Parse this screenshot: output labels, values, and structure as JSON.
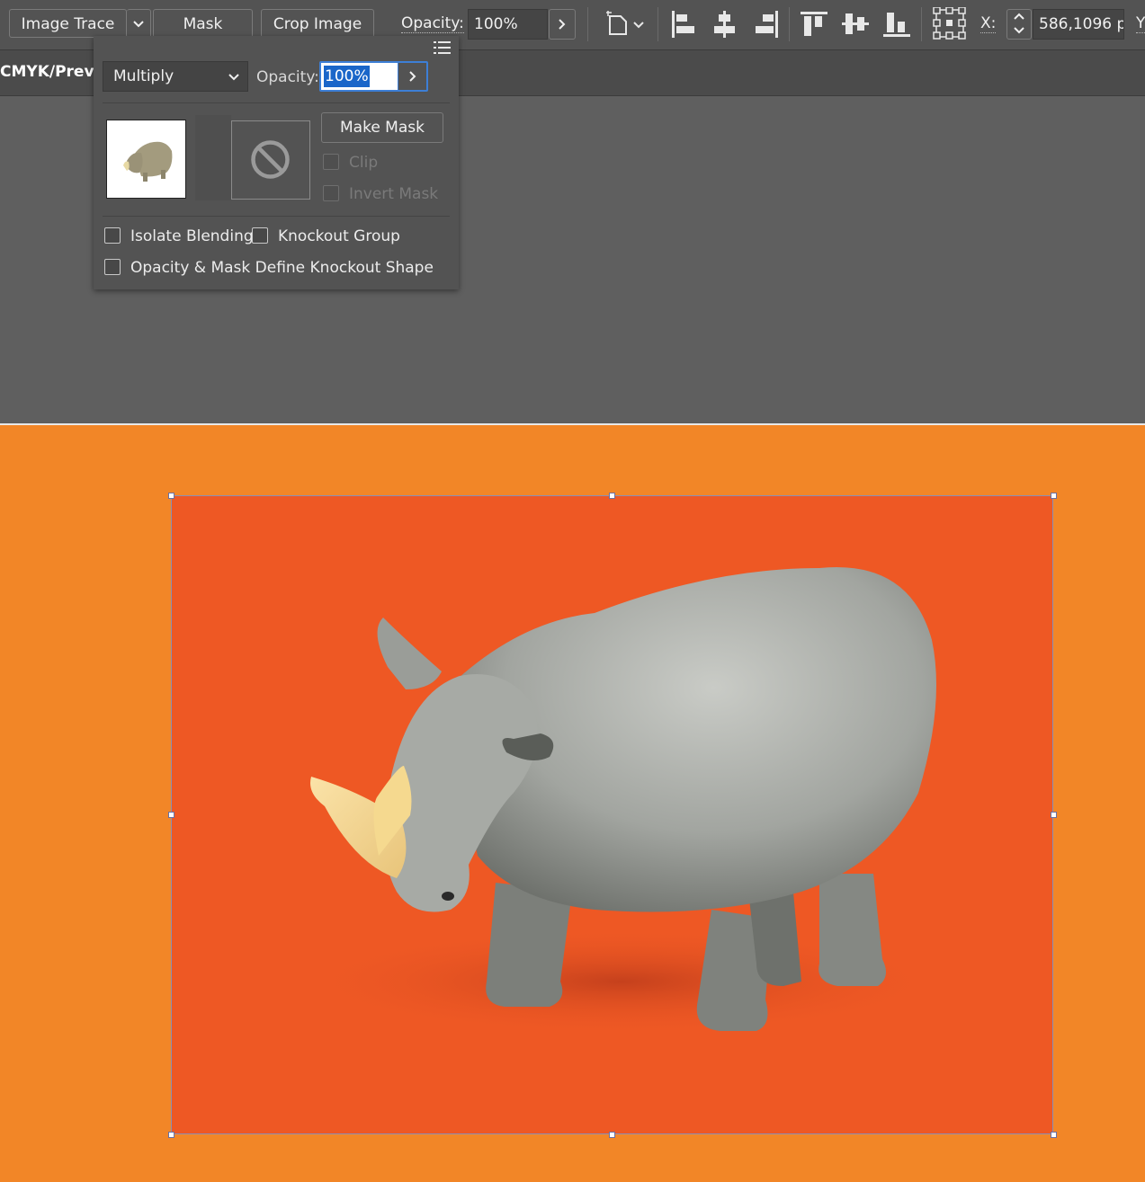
{
  "control_bar": {
    "image_trace_label": "Image Trace",
    "mask_label": "Mask",
    "crop_image_label": "Crop Image",
    "opacity_label": "Opacity:",
    "opacity_value": "100%",
    "x_label": "X:",
    "x_value": "586,1096 p",
    "y_label": "Y:"
  },
  "document_tab": {
    "label": "CMYK/Previ"
  },
  "transparency_panel": {
    "blend_mode": "Multiply",
    "opacity_label": "Opacity:",
    "opacity_value": "100%",
    "make_mask_label": "Make Mask",
    "clip_label": "Clip",
    "invert_mask_label": "Invert Mask",
    "isolate_blending_label": "Isolate Blending",
    "knockout_group_label": "Knockout Group",
    "opacity_mask_knockout_label": "Opacity & Mask Define Knockout Shape"
  },
  "colors": {
    "artboard_background": "#f28627",
    "image_background": "#ee5824",
    "ui_panel": "#535353",
    "selection_highlight": "#1a66c9"
  }
}
